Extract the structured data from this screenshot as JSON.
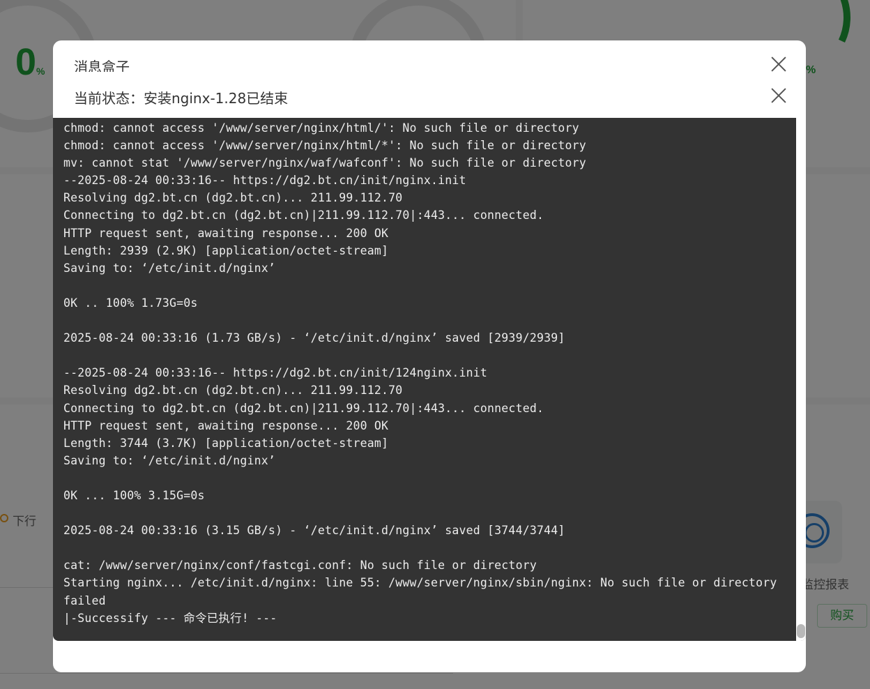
{
  "background": {
    "cpu_percent": "0",
    "percent_sign": "%",
    "right_percent_sign": "%",
    "download_label": "下行",
    "report_label": "监控报表",
    "buy_label": "购买"
  },
  "dialog_back": {
    "title": "消息盒子"
  },
  "dialog_front": {
    "title": "当前状态：安装nginx-1.28已结束"
  },
  "terminal": {
    "lines": [
      "chmod: cannot access '/www/server/nginx/html/': No such file or directory",
      "chmod: cannot access '/www/server/nginx/html/*': No such file or directory",
      "mv: cannot stat '/www/server/nginx/waf/wafconf': No such file or directory",
      "--2025-08-24 00:33:16-- https://dg2.bt.cn/init/nginx.init",
      "Resolving dg2.bt.cn (dg2.bt.cn)... 211.99.112.70",
      "Connecting to dg2.bt.cn (dg2.bt.cn)|211.99.112.70|:443... connected.",
      "HTTP request sent, awaiting response... 200 OK",
      "Length: 2939 (2.9K) [application/octet-stream]",
      "Saving to: ‘/etc/init.d/nginx’",
      "",
      "0K .. 100% 1.73G=0s",
      "",
      "2025-08-24 00:33:16 (1.73 GB/s) - ‘/etc/init.d/nginx’ saved [2939/2939]",
      "",
      "--2025-08-24 00:33:16-- https://dg2.bt.cn/init/124nginx.init",
      "Resolving dg2.bt.cn (dg2.bt.cn)... 211.99.112.70",
      "Connecting to dg2.bt.cn (dg2.bt.cn)|211.99.112.70|:443... connected.",
      "HTTP request sent, awaiting response... 200 OK",
      "Length: 3744 (3.7K) [application/octet-stream]",
      "Saving to: ‘/etc/init.d/nginx’",
      "",
      "0K ... 100% 3.15G=0s",
      "",
      "2025-08-24 00:33:16 (3.15 GB/s) - ‘/etc/init.d/nginx’ saved [3744/3744]",
      "",
      "cat: /www/server/nginx/conf/fastcgi.conf: No such file or directory",
      "Starting nginx... /etc/init.d/nginx: line 55: /www/server/nginx/sbin/nginx: No such file or directory",
      "failed",
      "|-Successify --- 命令已执行! ---"
    ]
  }
}
